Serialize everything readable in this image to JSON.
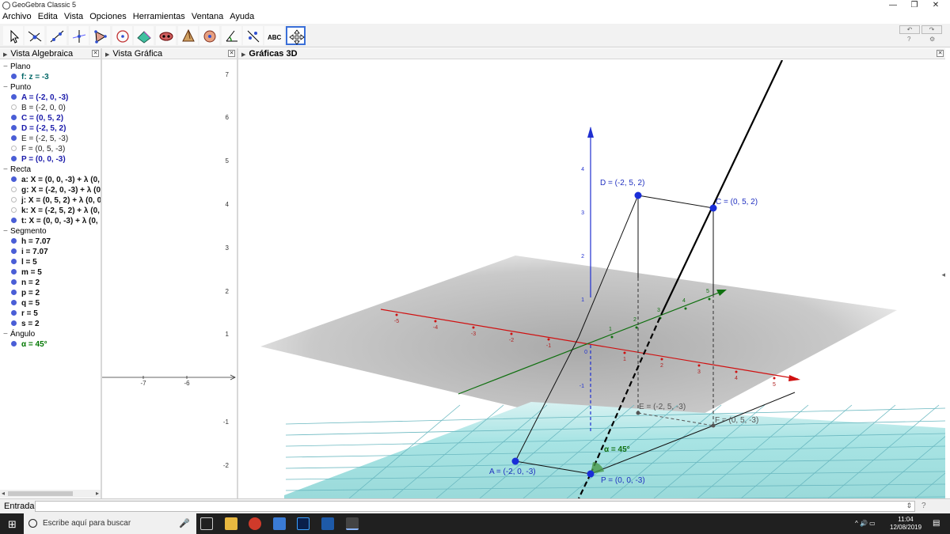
{
  "window": {
    "title": "GeoGebra Classic 5"
  },
  "menu": [
    "Archivo",
    "Edita",
    "Vista",
    "Opciones",
    "Herramientas",
    "Ventana",
    "Ayuda"
  ],
  "toolbar": {
    "tools": [
      "move-tool-icon",
      "point-tool-icon",
      "line-tool-icon",
      "perpendicular-tool-icon",
      "polygon-tool-icon",
      "circle-tool-icon",
      "plane-tool-icon",
      "intersect-tool-icon",
      "pyramid-tool-icon",
      "sphere-tool-icon",
      "angle-tool-icon",
      "reflect-tool-icon",
      "text-tool-icon",
      "move-view-tool-icon"
    ],
    "text_tool_label": "ABC"
  },
  "panels": {
    "algebra_title": "Vista Algebraica",
    "graphics_title": "Vista Gráfica",
    "graphics3d_title": "Gráficas 3D"
  },
  "algebra": {
    "categories": [
      {
        "name": "Plano",
        "items": [
          {
            "text": "f: z = -3",
            "style": "teal",
            "shown": true
          }
        ]
      },
      {
        "name": "Punto",
        "items": [
          {
            "text": "A = (-2, 0, -3)",
            "style": "blue",
            "shown": true
          },
          {
            "text": "B = (-2, 0, 0)",
            "style": "plain",
            "shown": false
          },
          {
            "text": "C = (0, 5, 2)",
            "style": "blue",
            "shown": true
          },
          {
            "text": "D = (-2, 5, 2)",
            "style": "blue",
            "shown": true
          },
          {
            "text": "E = (-2, 5, -3)",
            "style": "plain",
            "shown": true
          },
          {
            "text": "F = (0, 5, -3)",
            "style": "plain",
            "shown": false
          },
          {
            "text": "P = (0, 0, -3)",
            "style": "blue",
            "shown": true
          }
        ]
      },
      {
        "name": "Recta",
        "items": [
          {
            "text": "a: X = (0, 0, -3) + λ (0,",
            "style": "bold",
            "shown": true
          },
          {
            "text": "g: X = (-2, 0, -3) + λ (0",
            "style": "bold",
            "shown": false
          },
          {
            "text": "j: X = (0, 5, 2) + λ (0, 0",
            "style": "bold",
            "shown": false
          },
          {
            "text": "k: X = (-2, 5, 2) + λ (0,",
            "style": "bold",
            "shown": false
          },
          {
            "text": "t: X = (0, 0, -3) + λ (0, !",
            "style": "bold",
            "shown": true
          }
        ]
      },
      {
        "name": "Segmento",
        "items": [
          {
            "text": "h = 7.07",
            "style": "bold",
            "shown": true
          },
          {
            "text": "i = 7.07",
            "style": "bold",
            "shown": true
          },
          {
            "text": "l = 5",
            "style": "bold",
            "shown": true
          },
          {
            "text": "m = 5",
            "style": "bold",
            "shown": true
          },
          {
            "text": "n = 2",
            "style": "bold",
            "shown": true
          },
          {
            "text": "p = 2",
            "style": "bold",
            "shown": true
          },
          {
            "text": "q = 5",
            "style": "bold",
            "shown": true
          },
          {
            "text": "r = 5",
            "style": "bold",
            "shown": true
          },
          {
            "text": "s = 2",
            "style": "bold",
            "shown": true
          }
        ]
      },
      {
        "name": "Ángulo",
        "items": [
          {
            "text": "α = 45°",
            "style": "green",
            "shown": true
          }
        ]
      }
    ]
  },
  "graphics2d": {
    "y_ticks": [
      "7",
      "6",
      "5",
      "4",
      "3",
      "2",
      "1",
      "-1",
      "-2"
    ],
    "x_ticks": [
      "-7",
      "-6"
    ]
  },
  "graphics3d": {
    "point_labels": {
      "D": "D = (-2, 5, 2)",
      "C": "C = (0, 5, 2)",
      "E": "E = (-2, 5, -3)",
      "F": "F = (0, 5, -3)",
      "A": "A = (-2, 0, -3)",
      "P": "P = (0, 0, -3)"
    },
    "angle_label": "α = 45°",
    "z_ticks": [
      "4",
      "3",
      "2",
      "1",
      "-1"
    ],
    "x_ticks": [
      "-5",
      "-4",
      "-3",
      "-2",
      "-1",
      "0",
      "1",
      "2",
      "3",
      "4",
      "5"
    ],
    "y_ticks": [
      "1",
      "2",
      "3",
      "4",
      "5"
    ],
    "origin": "0"
  },
  "input_bar": {
    "label": "Entrada:"
  },
  "taskbar": {
    "search_placeholder": "Escribe aquí para buscar",
    "time": "11:04",
    "date": "12/08/2019"
  }
}
